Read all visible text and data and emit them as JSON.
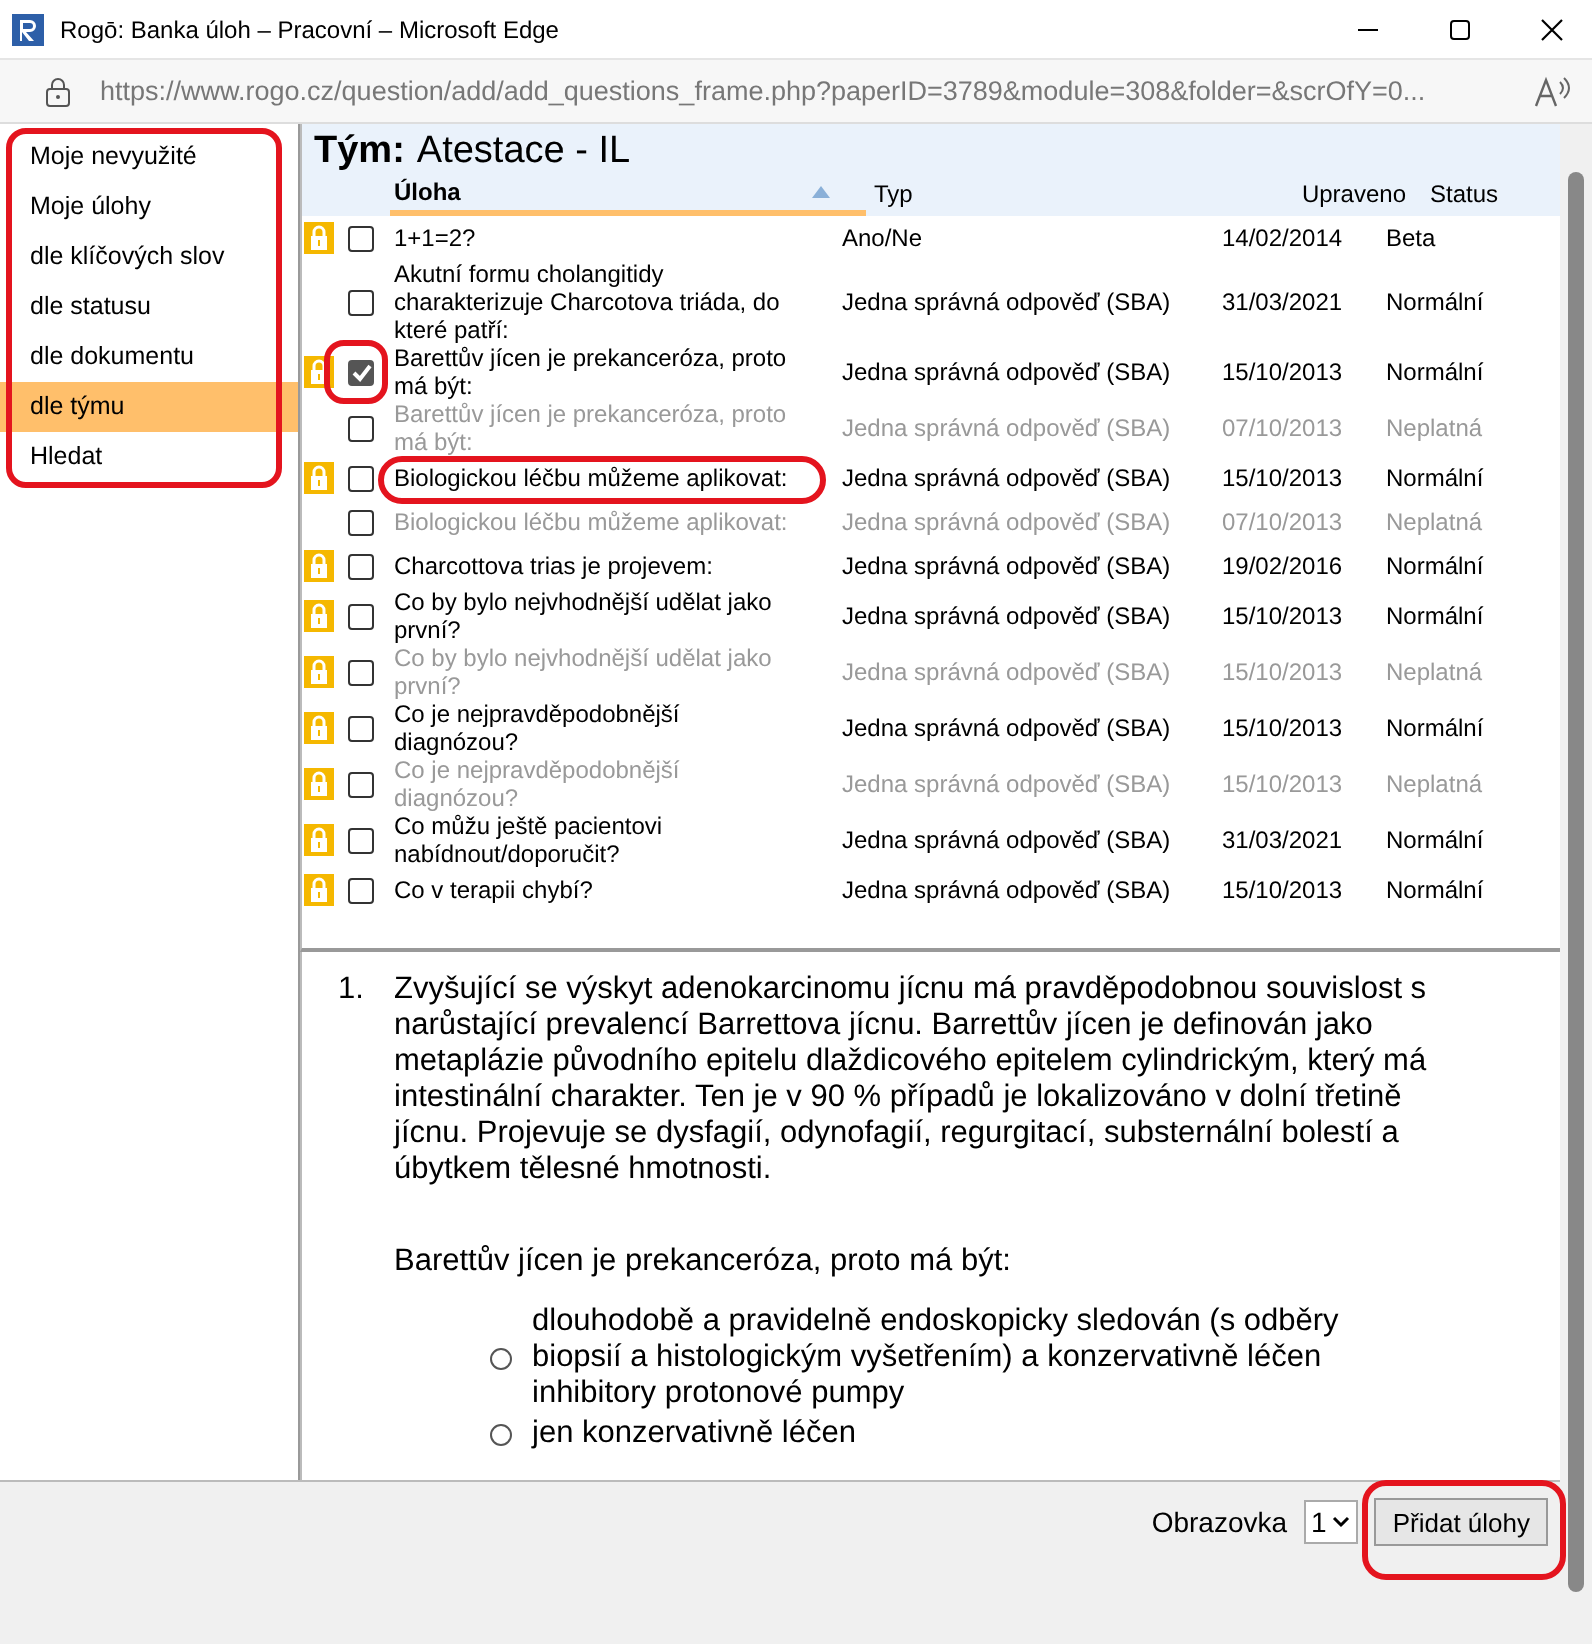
{
  "window": {
    "title": "Rogō: Banka úloh – Pracovní – Microsoft Edge"
  },
  "address_bar": {
    "url_host": "https://www.rogo.cz",
    "url_path": "/question/add/add_questions_frame.php?paperID=3789&module=308&folder=&scrOfY=0..."
  },
  "sidebar": {
    "items": [
      {
        "label": "Moje nevyužité",
        "selected": false
      },
      {
        "label": "Moje úlohy",
        "selected": false
      },
      {
        "label": "dle klíčových slov",
        "selected": false
      },
      {
        "label": "dle statusu",
        "selected": false
      },
      {
        "label": "dle dokumentu",
        "selected": false
      },
      {
        "label": "dle týmu",
        "selected": true
      },
      {
        "label": "Hledat",
        "selected": false
      }
    ]
  },
  "team_header": {
    "label": "Tým:",
    "name": "Atestace - IL"
  },
  "table": {
    "columns": [
      {
        "label": "Úloha",
        "sorted": true
      },
      {
        "label": "Typ",
        "sorted": false
      },
      {
        "label": "Upraveno",
        "sorted": false
      },
      {
        "label": "Status",
        "sorted": false
      }
    ],
    "rows": [
      {
        "locked": true,
        "checked": false,
        "inactive": false,
        "question": "1+1=2?",
        "type": "Ano/Ne",
        "modified": "14/02/2014",
        "status": "Beta"
      },
      {
        "locked": false,
        "checked": false,
        "inactive": false,
        "question": "Akutní formu cholangitidy charakterizuje Charcotova triáda, do které patří:",
        "type": "Jedna správná odpověď (SBA)",
        "modified": "31/03/2021",
        "status": "Normální"
      },
      {
        "locked": true,
        "checked": true,
        "inactive": false,
        "question": "Barettův jícen je prekanceróza, proto má být:",
        "type": "Jedna správná odpověď (SBA)",
        "modified": "15/10/2013",
        "status": "Normální"
      },
      {
        "locked": false,
        "checked": false,
        "inactive": true,
        "question": "Barettův jícen je prekanceróza, proto má být:",
        "type": "Jedna správná odpověď (SBA)",
        "modified": "07/10/2013",
        "status": "Neplatná"
      },
      {
        "locked": true,
        "checked": false,
        "inactive": false,
        "question": "Biologickou léčbu můžeme aplikovat:",
        "type": "Jedna správná odpověď (SBA)",
        "modified": "15/10/2013",
        "status": "Normální"
      },
      {
        "locked": false,
        "checked": false,
        "inactive": true,
        "question": "Biologickou léčbu můžeme aplikovat:",
        "type": "Jedna správná odpověď (SBA)",
        "modified": "07/10/2013",
        "status": "Neplatná"
      },
      {
        "locked": true,
        "checked": false,
        "inactive": false,
        "question": "Charcottova trias je projevem:",
        "type": "Jedna správná odpověď (SBA)",
        "modified": "19/02/2016",
        "status": "Normální"
      },
      {
        "locked": true,
        "checked": false,
        "inactive": false,
        "question": "Co by bylo nejvhodnější udělat jako první?",
        "type": "Jedna správná odpověď (SBA)",
        "modified": "15/10/2013",
        "status": "Normální"
      },
      {
        "locked": true,
        "checked": false,
        "inactive": true,
        "question": "Co by bylo nejvhodnější udělat jako první?",
        "type": "Jedna správná odpověď (SBA)",
        "modified": "15/10/2013",
        "status": "Neplatná"
      },
      {
        "locked": true,
        "checked": false,
        "inactive": false,
        "question": "Co je nejpravděpodobnější diagnózou?",
        "type": "Jedna správná odpověď (SBA)",
        "modified": "15/10/2013",
        "status": "Normální"
      },
      {
        "locked": true,
        "checked": false,
        "inactive": true,
        "question": "Co je nejpravděpodobnější diagnózou?",
        "type": "Jedna správná odpověď (SBA)",
        "modified": "15/10/2013",
        "status": "Neplatná"
      },
      {
        "locked": true,
        "checked": false,
        "inactive": false,
        "question": "Co můžu ještě pacientovi nabídnout/doporučit?",
        "type": "Jedna správná odpověď (SBA)",
        "modified": "31/03/2021",
        "status": "Normální"
      },
      {
        "locked": true,
        "checked": false,
        "inactive": false,
        "question": "Co v terapii chybí?",
        "type": "Jedna správná odpověď (SBA)",
        "modified": "15/10/2013",
        "status": "Normální"
      }
    ]
  },
  "preview": {
    "number": "1.",
    "paragraph": "Zvyšující se výskyt adenokarcinomu jícnu má pravděpodobnou souvislost s narůstající prevalencí Barrettova jícnu. Barrettův jícen je definován jako metaplázie původního epitelu dlaždicového epitelem cylindrickým, který má intestinální charakter. Ten je v 90 % případů je lokalizováno v dolní třetině jícnu. Projevuje se dysfagií, odynofagií, regurgitací, substernální bolestí a úbytkem tělesné hmotnosti.",
    "question": "Barettův jícen je prekanceróza, proto má být:",
    "options": [
      {
        "label": "dlouhodobě a pravidelně endoskopicky sledován (s odběry biopsií a histologickým vyšetřením) a konzervativně léčen inhibitory protonové pumpy",
        "selected": false
      },
      {
        "label": "jen konzervativně léčen",
        "selected": false
      }
    ]
  },
  "footer": {
    "label": "Obrazovka",
    "page": "1",
    "button": "Přidat úlohy"
  }
}
